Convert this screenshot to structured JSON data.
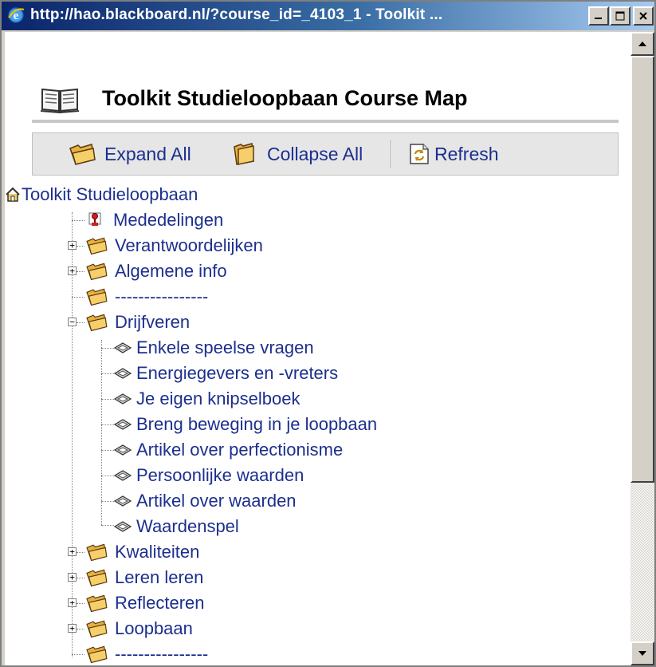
{
  "window": {
    "title": "http://hao.blackboard.nl/?course_id=_4103_1 - Toolkit ..."
  },
  "page": {
    "title": "Toolkit Studieloopbaan Course Map"
  },
  "actions": {
    "expand_all": "Expand All",
    "collapse_all": "Collapse All",
    "refresh": "Refresh"
  },
  "tree": {
    "root": "Toolkit Studieloopbaan",
    "items": [
      {
        "label": "Mededelingen",
        "icon": "pushpin-icon",
        "expander": "none"
      },
      {
        "label": "Verantwoordelijken",
        "icon": "folder-icon",
        "expander": "plus"
      },
      {
        "label": "Algemene info",
        "icon": "folder-icon",
        "expander": "plus"
      },
      {
        "label": "----------------",
        "icon": "folder-icon",
        "expander": "none"
      },
      {
        "label": "Drijfveren",
        "icon": "folder-icon",
        "expander": "minus"
      },
      {
        "label": "Kwaliteiten",
        "icon": "folder-icon",
        "expander": "plus"
      },
      {
        "label": "Leren leren",
        "icon": "folder-icon",
        "expander": "plus"
      },
      {
        "label": "Reflecteren",
        "icon": "folder-icon",
        "expander": "plus"
      },
      {
        "label": "Loopbaan",
        "icon": "folder-icon",
        "expander": "plus"
      },
      {
        "label": "----------------",
        "icon": "folder-icon",
        "expander": "none"
      }
    ],
    "drijfveren_children": [
      "Enkele speelse vragen",
      "Energiegevers en -vreters",
      "Je eigen knipselboek",
      "Breng beweging in je loopbaan",
      "Artikel over perfectionisme",
      "Persoonlijke waarden",
      "Artikel over waarden",
      "Waardenspel"
    ]
  },
  "colors": {
    "link": "#1c2f8e",
    "titlebar_start": "#0a246a",
    "titlebar_end": "#a6caf0"
  }
}
